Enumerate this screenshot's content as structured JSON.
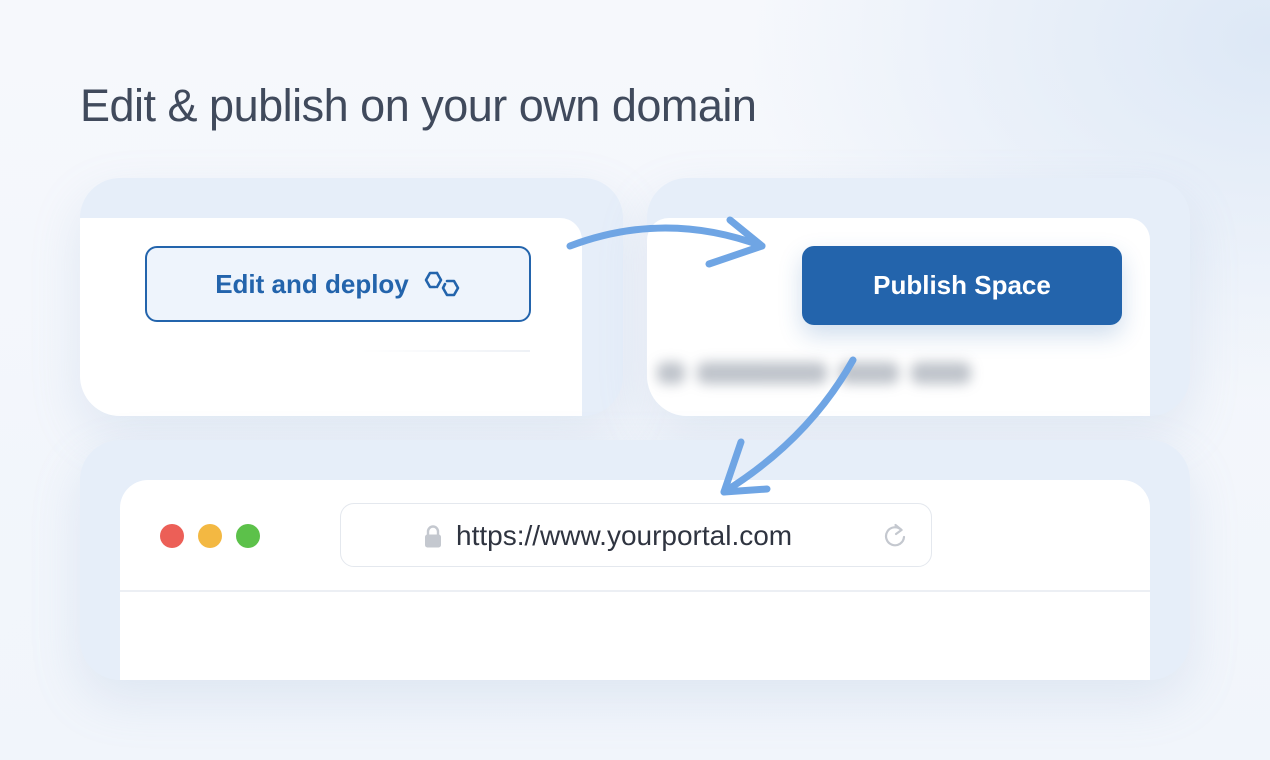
{
  "headline": "Edit & publish on your own domain",
  "edit_card": {
    "button_label": "Edit and deploy",
    "button_icon": "deploy-links-icon"
  },
  "publish_card": {
    "button_label": "Publish Space"
  },
  "browser": {
    "window_controls": [
      "close",
      "minimize",
      "maximize"
    ],
    "url": "https://www.yourportal.com",
    "lock_icon": "lock-icon",
    "reload_icon": "reload-icon"
  },
  "colors": {
    "accent": "#2364ac",
    "arrow": "#6fa5e4",
    "headline": "#404a5c",
    "panel": "#e6eef9",
    "traffic_red": "#ec5f57",
    "traffic_yellow": "#f3b842",
    "traffic_green": "#5cc14a"
  }
}
